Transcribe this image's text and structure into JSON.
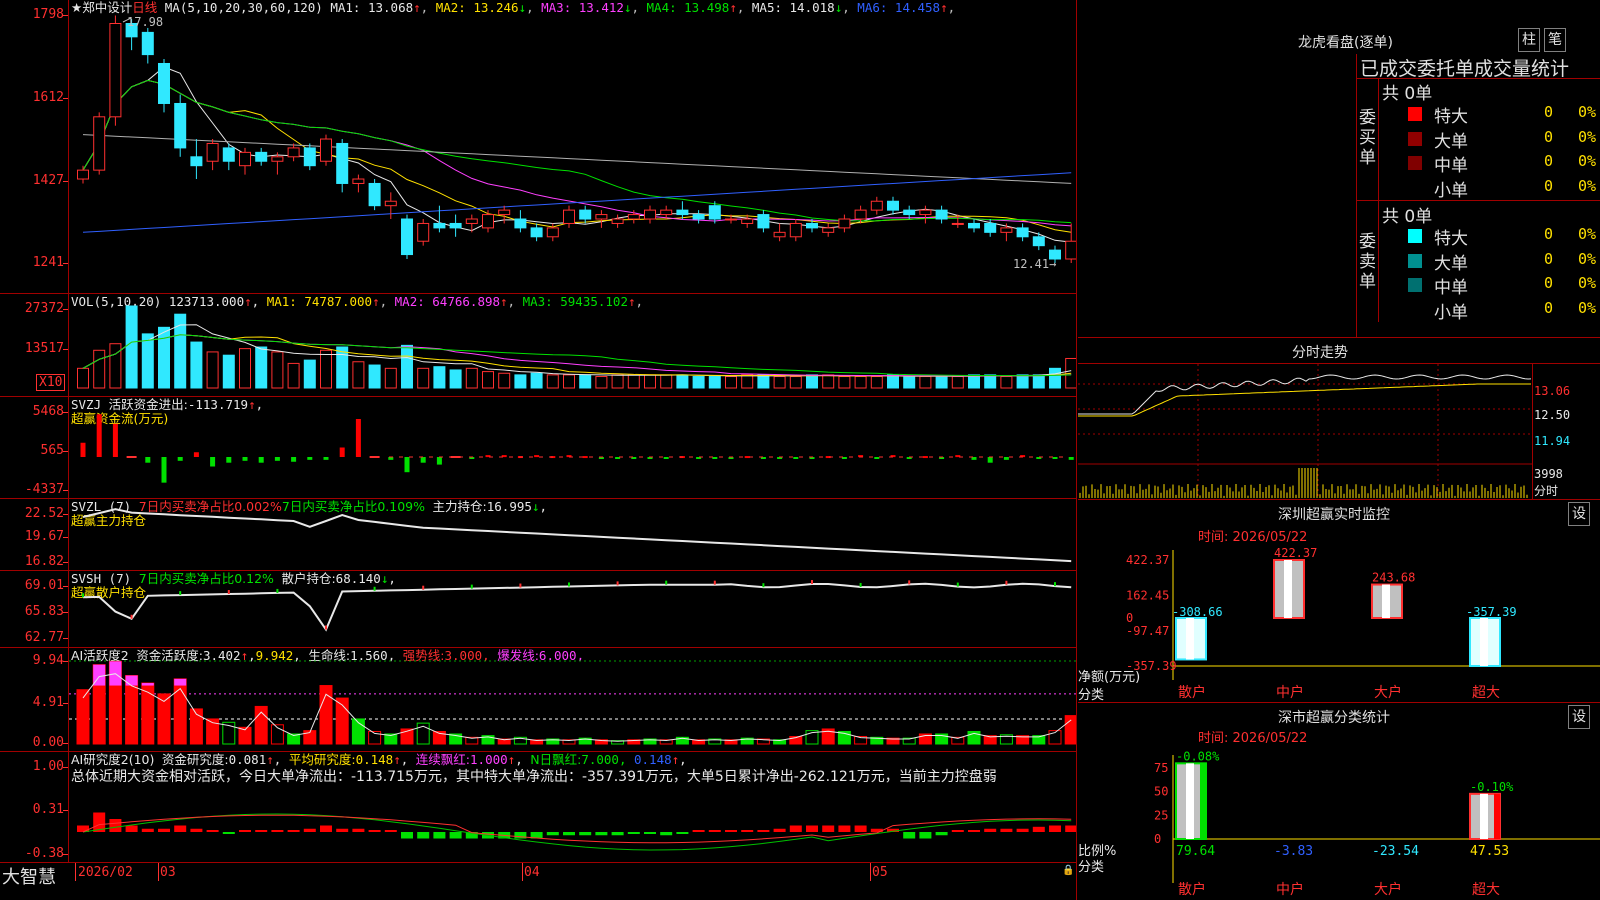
{
  "main": {
    "stock_name": "★郑中设计",
    "period": "日线",
    "ma_def": "MA(5,10,20,30,60,120)",
    "ma": [
      {
        "label": "MA1:",
        "value": "13.068",
        "arrow": "↑",
        "color": "#e8e8e8"
      },
      {
        "label": "MA2:",
        "value": "13.246",
        "arrow": "↓",
        "color": "#ffe000"
      },
      {
        "label": "MA3:",
        "value": "13.412",
        "arrow": "↓",
        "color": "#ff40ff"
      },
      {
        "label": "MA4:",
        "value": "13.498",
        "arrow": "↑",
        "color": "#00e000"
      },
      {
        "label": "MA5:",
        "value": "14.018",
        "arrow": "↓",
        "color": "#e8e8e8"
      },
      {
        "label": "MA6:",
        "value": "14.458",
        "arrow": "↑",
        "color": "#3060ff"
      }
    ],
    "yticks": [
      "1798",
      "1612",
      "1427",
      "1241"
    ],
    "high_label": "17.98",
    "low_label": "12.41→",
    "ohlc": [
      [
        14.3,
        14.6,
        14.2,
        14.5
      ],
      [
        14.5,
        15.8,
        14.4,
        15.7
      ],
      [
        15.7,
        17.98,
        15.5,
        17.8
      ],
      [
        17.8,
        17.9,
        17.2,
        17.5
      ],
      [
        17.6,
        17.7,
        16.9,
        17.1
      ],
      [
        16.9,
        17.0,
        15.8,
        16.0
      ],
      [
        16.0,
        16.2,
        14.8,
        15.0
      ],
      [
        14.8,
        15.2,
        14.3,
        14.6
      ],
      [
        14.7,
        15.2,
        14.5,
        15.1
      ],
      [
        15.0,
        15.1,
        14.5,
        14.7
      ],
      [
        14.6,
        15.0,
        14.4,
        14.9
      ],
      [
        14.9,
        15.0,
        14.6,
        14.7
      ],
      [
        14.7,
        14.9,
        14.4,
        14.8
      ],
      [
        14.8,
        15.1,
        14.7,
        15.0
      ],
      [
        15.0,
        15.1,
        14.5,
        14.6
      ],
      [
        14.7,
        15.3,
        14.6,
        15.2
      ],
      [
        15.1,
        15.2,
        14.0,
        14.2
      ],
      [
        14.2,
        14.4,
        14.0,
        14.3
      ],
      [
        14.2,
        14.3,
        13.6,
        13.7
      ],
      [
        13.7,
        14.0,
        13.4,
        13.8
      ],
      [
        13.4,
        13.5,
        12.5,
        12.6
      ],
      [
        12.9,
        13.4,
        12.8,
        13.3
      ],
      [
        13.3,
        13.7,
        13.1,
        13.2
      ],
      [
        13.3,
        13.5,
        13.0,
        13.2
      ],
      [
        13.3,
        13.5,
        13.1,
        13.4
      ],
      [
        13.2,
        13.6,
        13.1,
        13.5
      ],
      [
        13.5,
        13.7,
        13.3,
        13.6
      ],
      [
        13.4,
        13.6,
        13.1,
        13.2
      ],
      [
        13.2,
        13.3,
        12.9,
        13.0
      ],
      [
        13.0,
        13.3,
        12.9,
        13.2
      ],
      [
        13.3,
        13.7,
        13.2,
        13.6
      ],
      [
        13.6,
        13.7,
        13.3,
        13.4
      ],
      [
        13.4,
        13.6,
        13.2,
        13.5
      ],
      [
        13.3,
        13.5,
        13.2,
        13.4
      ],
      [
        13.4,
        13.6,
        13.3,
        13.5
      ],
      [
        13.4,
        13.7,
        13.3,
        13.6
      ],
      [
        13.5,
        13.7,
        13.4,
        13.6
      ],
      [
        13.6,
        13.8,
        13.4,
        13.5
      ],
      [
        13.5,
        13.6,
        13.3,
        13.4
      ],
      [
        13.7,
        13.8,
        13.3,
        13.4
      ],
      [
        13.4,
        13.5,
        13.3,
        13.4
      ],
      [
        13.3,
        13.5,
        13.2,
        13.4
      ],
      [
        13.5,
        13.6,
        13.1,
        13.2
      ],
      [
        13.0,
        13.3,
        12.9,
        13.1
      ],
      [
        13.0,
        13.4,
        12.9,
        13.3
      ],
      [
        13.3,
        13.4,
        13.1,
        13.2
      ],
      [
        13.1,
        13.3,
        13.0,
        13.2
      ],
      [
        13.2,
        13.5,
        13.1,
        13.4
      ],
      [
        13.4,
        13.7,
        13.3,
        13.6
      ],
      [
        13.6,
        13.9,
        13.5,
        13.8
      ],
      [
        13.8,
        13.9,
        13.5,
        13.6
      ],
      [
        13.6,
        13.7,
        13.4,
        13.5
      ],
      [
        13.5,
        13.7,
        13.3,
        13.6
      ],
      [
        13.6,
        13.7,
        13.3,
        13.4
      ],
      [
        13.3,
        13.5,
        13.2,
        13.3
      ],
      [
        13.3,
        13.4,
        13.1,
        13.2
      ],
      [
        13.3,
        13.4,
        13.0,
        13.1
      ],
      [
        13.1,
        13.3,
        12.9,
        13.2
      ],
      [
        13.2,
        13.3,
        12.9,
        13.0
      ],
      [
        13.0,
        13.1,
        12.7,
        12.8
      ],
      [
        12.7,
        12.8,
        12.41,
        12.5
      ],
      [
        12.5,
        13.3,
        12.41,
        12.9
      ]
    ]
  },
  "vol": {
    "title": "VOL(5,10,20)",
    "value": "123713.000",
    "arrow": "↑",
    "ma": [
      {
        "label": "MA1:",
        "value": "74787.000",
        "arrow": "↑",
        "color": "#ffe000"
      },
      {
        "label": "MA2:",
        "value": "64766.898",
        "arrow": "↑",
        "color": "#ff40ff"
      },
      {
        "label": "MA3:",
        "value": "59435.102",
        "arrow": "↑",
        "color": "#00e000"
      }
    ],
    "yticks": [
      "27372",
      "13517"
    ],
    "unit": "X10",
    "values": [
      1.2,
      2.3,
      2.7,
      5.0,
      3.3,
      3.7,
      4.5,
      2.8,
      2.2,
      2.0,
      2.4,
      2.5,
      2.2,
      1.5,
      1.7,
      2.3,
      2.5,
      1.6,
      1.4,
      1.2,
      2.6,
      1.2,
      1.3,
      1.1,
      1.2,
      1.0,
      0.9,
      0.8,
      0.9,
      0.8,
      0.8,
      0.8,
      0.7,
      0.8,
      0.8,
      0.8,
      0.8,
      0.8,
      0.7,
      0.7,
      0.7,
      0.8,
      0.8,
      0.7,
      0.7,
      0.8,
      0.8,
      0.7,
      0.7,
      0.7,
      0.8,
      0.7,
      0.7,
      0.7,
      0.7,
      0.8,
      0.8,
      0.7,
      0.8,
      0.8,
      1.2,
      1.8
    ]
  },
  "svzj": {
    "title": "SVZJ",
    "label": "活跃资金进出:",
    "value": "-113.719",
    "arrow": "↑",
    "sub": "超赢资金流(万元)",
    "yticks": [
      "5468",
      "565",
      "-4337"
    ],
    "values": [
      1.5,
      4.5,
      3.5,
      0,
      -0.6,
      -2.7,
      -0.4,
      0.5,
      -1.0,
      -0.6,
      -0.4,
      -0.6,
      -0.4,
      -0.5,
      -0.3,
      -0.3,
      1.0,
      4.0,
      0,
      -0.3,
      -1.6,
      -0.6,
      -0.8,
      0,
      -0.1,
      0.2,
      0.2,
      0.1,
      0.2,
      0.1,
      0.2,
      0.1,
      -0.1,
      -0.1,
      -0.2,
      -0.1,
      -0.2,
      0.1,
      -0.2,
      -0.1,
      -0.2,
      0.1,
      -0.1,
      -0.2,
      -0.1,
      -0.2,
      0.1,
      -0.1,
      0.2,
      -0.1,
      0.2,
      -0.2,
      0.1,
      -0.2,
      0.2,
      -0.3,
      -0.6,
      -0.3,
      0.2,
      -0.1,
      -0.2,
      -0.3
    ]
  },
  "svzl": {
    "title": "SVZL (7)",
    "seg1": "7日内买卖净占比0.002%",
    "seg2": "7日内买卖净占比0.109%",
    "seg3": "主力持仓:",
    "value": "16.995",
    "arrow": "↓",
    "sub": "超赢主力持仓",
    "yticks": [
      "22.52",
      "19.67",
      "16.82"
    ]
  },
  "svsh": {
    "title": "SVSH (7)",
    "seg1": "7日内买卖净占比0.12%",
    "seg2": "散户持仓:",
    "value": "68.140",
    "arrow": "↓",
    "sub": "超赢散户持仓",
    "yticks": [
      "69.01",
      "65.83",
      "62.77"
    ]
  },
  "ai1": {
    "title": "AI活跃度2",
    "seg1": "资金活跃度:",
    "value1": "3.402",
    "arrow1": "↑",
    "value2": "9.942",
    "seg2": "生命线:",
    "value3": "1.560",
    "seg3": "强势线:",
    "value4": "3.000",
    "seg4": "爆发线:",
    "value5": "6.000",
    "yticks": [
      "9.94",
      "4.91",
      "0.00"
    ],
    "values": [
      6.5,
      9.5,
      9.9,
      8.2,
      7.3,
      6.0,
      7.8,
      4.2,
      3.0,
      2.6,
      2.0,
      4.5,
      2.3,
      1.2,
      1.6,
      7.0,
      5.5,
      3.0,
      1.5,
      1.2,
      1.8,
      2.5,
      1.5,
      1.2,
      0.8,
      1.0,
      0.6,
      0.8,
      0.5,
      0.6,
      0.5,
      0.7,
      0.5,
      0.4,
      0.5,
      0.6,
      0.5,
      0.8,
      0.5,
      0.6,
      0.5,
      0.7,
      0.6,
      0.5,
      0.9,
      1.6,
      1.8,
      1.5,
      0.9,
      0.8,
      0.7,
      0.7,
      1.2,
      1.2,
      0.8,
      1.5,
      1.0,
      1.1,
      1.0,
      1.0,
      1.6,
      3.4
    ]
  },
  "ai2": {
    "title": "AI研究度2(10)",
    "seg1": "资金研究度:",
    "value1": "0.081",
    "arrow1": "↑",
    "seg2": "平均研究度:",
    "value2": "0.148",
    "arrow2": "↑",
    "seg3": "连续飘红:",
    "value3": "1.000",
    "arrow3": "↑",
    "seg4": "N日飘红:",
    "value4": "7.000,",
    "value5": "0.148",
    "arrow5": "↑",
    "summary": "总体近期大资金相对活跃，今日大单净流出：-113.715万元，其中特大单净流出：-357.391万元，大单5日累计净出-262.121万元，当前主力控盘弱",
    "yticks": [
      "1.00",
      "0.31",
      "-0.38"
    ]
  },
  "xaxis": {
    "labels": [
      {
        "t": "2026/02"
      },
      {
        "t": "03"
      },
      {
        "t": "04"
      },
      {
        "t": "05"
      }
    ]
  },
  "brand": "大智慧",
  "dragon": {
    "title": "龙虎看盘(逐单)",
    "btn1": "柱",
    "btn2": "笔",
    "subtitle": "已成交委托单成交量统计",
    "buy_label": "委买单",
    "sell_label": "委卖单",
    "buy_total": "共 0单",
    "sell_total": "共 0单",
    "buy": [
      {
        "label": "特大",
        "count": "0",
        "pct": "0%",
        "color": "#ff0000"
      },
      {
        "label": "大单",
        "count": "0",
        "pct": "0%",
        "color": "#900000"
      },
      {
        "label": "中单",
        "count": "0",
        "pct": "0%",
        "color": "#800000"
      },
      {
        "label": "小单",
        "count": "0",
        "pct": "0%",
        "color": "#000000"
      }
    ],
    "sell": [
      {
        "label": "特大",
        "count": "0",
        "pct": "0%",
        "color": "#00ffff"
      },
      {
        "label": "大单",
        "count": "0",
        "pct": "0%",
        "color": "#009090"
      },
      {
        "label": "中单",
        "count": "0",
        "pct": "0%",
        "color": "#007070"
      },
      {
        "label": "小单",
        "count": "0",
        "pct": "0%",
        "color": "#000000"
      }
    ]
  },
  "intraday": {
    "title": "分时走势",
    "yticks": [
      "13.06",
      "12.50",
      "11.94"
    ],
    "vol_label": "3998",
    "unit": "分时"
  },
  "monitor": {
    "title": "深圳超赢实时监控",
    "btn": "设",
    "time": "时间: 2026/05/22",
    "yticks": [
      "422.37",
      "162.45",
      "0",
      "-97.47",
      "-357.39"
    ],
    "ylabel": "净额(万元)",
    "xlabel": "分类",
    "bars": [
      {
        "cat": "散户",
        "value": -308.66,
        "label": "-308.66",
        "catcolor": "#ff3030"
      },
      {
        "cat": "中户",
        "value": 422.37,
        "label": "422.37",
        "catcolor": "#ff3030"
      },
      {
        "cat": "大户",
        "value": 243.68,
        "label": "243.68",
        "catcolor": "#ff3030"
      },
      {
        "cat": "超大",
        "value": -357.39,
        "label": "-357.39",
        "catcolor": "#ff3030"
      }
    ]
  },
  "stats": {
    "title": "深市超赢分类统计",
    "btn": "设",
    "time": "时间: 2026/05/22",
    "yticks": [
      "75",
      "50",
      "25",
      "0"
    ],
    "ylabel": "比例%",
    "xlabel": "分类",
    "bars": [
      {
        "cat": "散户",
        "pct": 79.64,
        "label": "79.64",
        "top": "-0.08%",
        "valcolor": "#00e000"
      },
      {
        "cat": "中户",
        "pct": -3.83,
        "label": "-3.83",
        "top": "",
        "valcolor": "#3060ff"
      },
      {
        "cat": "大户",
        "pct": -23.54,
        "label": "-23.54",
        "top": "",
        "valcolor": "#30e8ff"
      },
      {
        "cat": "超大",
        "pct": 47.53,
        "label": "47.53",
        "top": "-0.10%",
        "valcolor": "#ffe000"
      }
    ]
  }
}
